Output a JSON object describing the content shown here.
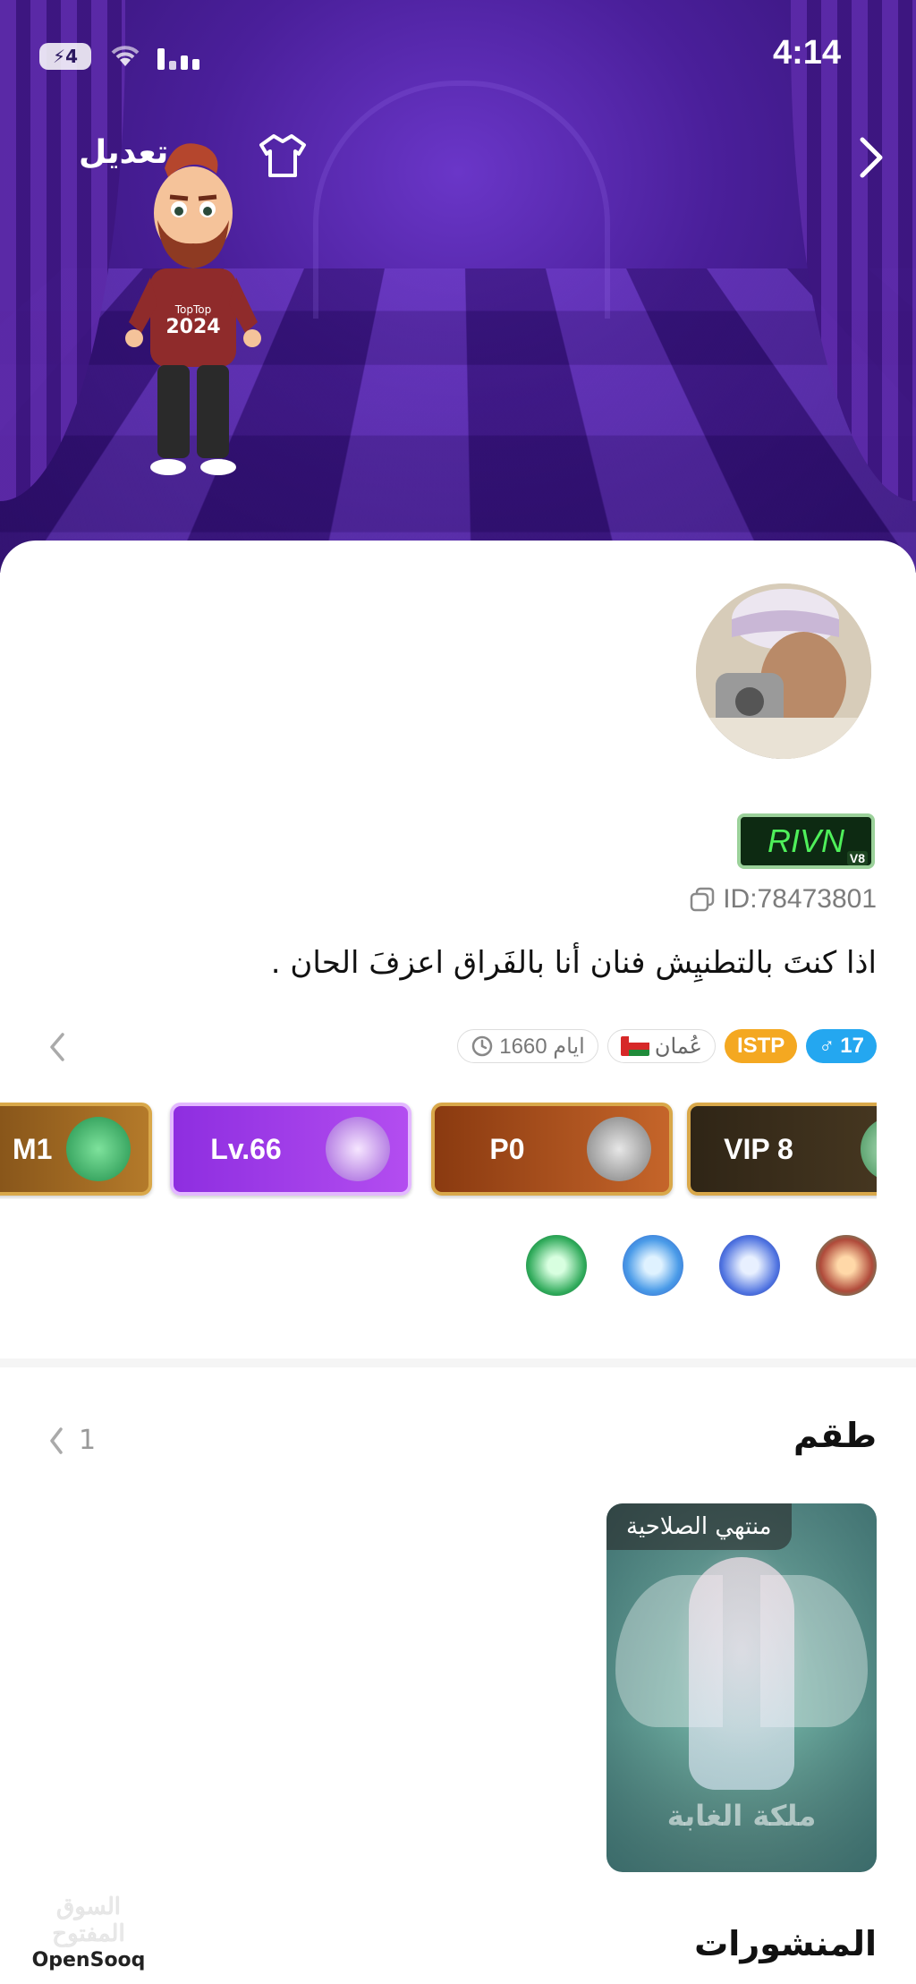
{
  "status_bar": {
    "battery": "4",
    "time": "4:14"
  },
  "header": {
    "edit_label": "تعديل"
  },
  "avatar": {
    "shirt_brand": "TopTop",
    "shirt_year": "2024"
  },
  "profile": {
    "name_badge": "RIVN",
    "name_badge_suffix": "V8",
    "id": "ID:78473801",
    "bio": "اذا كنتَ بالتطنيِش فنان أنا بالفَراق اعزفَ الحان ."
  },
  "tags": {
    "gender_age": "17",
    "mbti": "ISTP",
    "country": "عُمان",
    "days": "1660 ايام"
  },
  "levels": [
    {
      "label": "VIP 8"
    },
    {
      "label": "P0"
    },
    {
      "label": "Lv.66"
    },
    {
      "label": "M1"
    }
  ],
  "badges": [
    "gift-badge",
    "crown-badge",
    "gift-box-badge",
    "treasure-badge"
  ],
  "sets": {
    "title": "طقم",
    "page": "1",
    "item": {
      "status": "منتهي الصلاحية",
      "name": "ملكة الغابة"
    }
  },
  "posts": {
    "title": "المنشورات"
  },
  "watermark": {
    "arabic": "السوق المفتوح",
    "english": "OpenSooq"
  },
  "colors": {
    "hero_bg": "#4a1f9a",
    "gender_tag": "#24a7f0",
    "mbti_tag": "#f4a821"
  }
}
